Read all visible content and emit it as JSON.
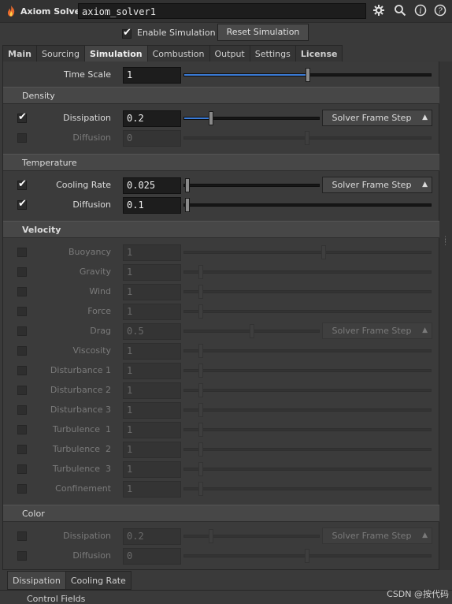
{
  "node": {
    "type_label": "Axiom Solver",
    "name": "axiom_solver1"
  },
  "toolbar_icons": [
    "gear-icon",
    "search-icon",
    "info-icon",
    "help-icon"
  ],
  "enable": {
    "label": "Enable Simulation",
    "checked": true,
    "reset_label": "Reset Simulation"
  },
  "tabs": [
    {
      "label": "Main",
      "bold": true,
      "active": false
    },
    {
      "label": "Sourcing",
      "bold": false,
      "active": false
    },
    {
      "label": "Simulation",
      "bold": true,
      "active": true
    },
    {
      "label": "Combustion",
      "bold": false,
      "active": false
    },
    {
      "label": "Output",
      "bold": false,
      "active": false
    },
    {
      "label": "Settings",
      "bold": false,
      "active": false
    },
    {
      "label": "License",
      "bold": true,
      "active": false
    }
  ],
  "time_scale": {
    "label": "Time Scale",
    "value": "1"
  },
  "density": {
    "title": "Density",
    "dissipation": {
      "label": "Dissipation",
      "value": "0.2",
      "checked": true,
      "menu": "Solver Frame Step"
    },
    "diffusion": {
      "label": "Diffusion",
      "value": "0",
      "checked": false
    }
  },
  "temperature": {
    "title": "Temperature",
    "cooling_rate": {
      "label": "Cooling Rate",
      "value": "0.025",
      "checked": true,
      "menu": "Solver Frame Step"
    },
    "diffusion": {
      "label": "Diffusion",
      "value": "0.1",
      "checked": true
    }
  },
  "velocity": {
    "title": "Velocity",
    "params": [
      {
        "label": "Buoyancy",
        "value": "1"
      },
      {
        "label": "Gravity",
        "value": "1"
      },
      {
        "label": "Wind",
        "value": "1"
      },
      {
        "label": "Force",
        "value": "1"
      },
      {
        "label": "Drag",
        "value": "0.5",
        "menu": "Solver Frame Step"
      },
      {
        "label": "Viscosity",
        "value": "1"
      },
      {
        "label": "Disturbance 1",
        "value": "1"
      },
      {
        "label": "Disturbance 2",
        "value": "1"
      },
      {
        "label": "Disturbance 3",
        "value": "1"
      },
      {
        "label": "Turbulence  1",
        "value": "1"
      },
      {
        "label": "Turbulence  2",
        "value": "1"
      },
      {
        "label": "Turbulence  3",
        "value": "1"
      },
      {
        "label": "Confinement",
        "value": "1"
      }
    ]
  },
  "color": {
    "title": "Color",
    "dissipation": {
      "label": "Dissipation",
      "value": "0.2",
      "menu": "Solver Frame Step"
    },
    "diffusion": {
      "label": "Diffusion",
      "value": "0"
    }
  },
  "bottom_tabs": [
    "Dissipation",
    "Cooling Rate"
  ],
  "below_label": "Control Fields",
  "watermark": "CSDN @按代码"
}
